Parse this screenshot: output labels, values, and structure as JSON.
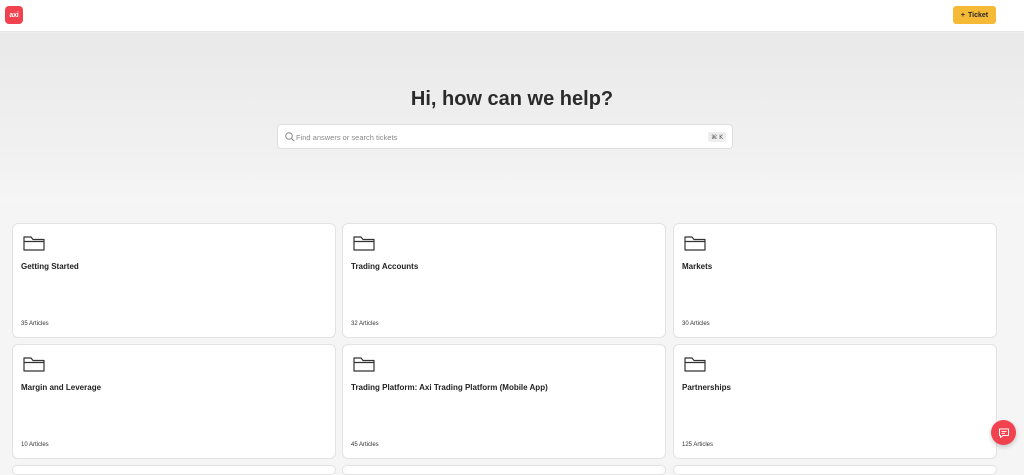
{
  "header": {
    "logo_text": "axi",
    "ticket_button_label": "Ticket",
    "ticket_button_icon": "plus-icon"
  },
  "hero": {
    "title": "Hi, how can we help?",
    "search": {
      "placeholder": "Find answers or search tickets",
      "value": "",
      "shortcut": "⌘ K"
    }
  },
  "categories": [
    {
      "title": "Getting Started",
      "count": "35 Articles",
      "icon": "folder-icon"
    },
    {
      "title": "Trading Accounts",
      "count": "32 Articles",
      "icon": "folder-icon"
    },
    {
      "title": "Markets",
      "count": "30 Articles",
      "icon": "folder-icon"
    },
    {
      "title": "Margin and Leverage",
      "count": "10 Articles",
      "icon": "folder-icon"
    },
    {
      "title": "Trading Platform: Axi Trading Platform (Mobile App)",
      "count": "45 Articles",
      "icon": "folder-icon"
    },
    {
      "title": "Partnerships",
      "count": "125 Articles",
      "icon": "folder-icon"
    }
  ],
  "chat_widget": {
    "icon": "chat-icon"
  },
  "colors": {
    "brand_red": "#f0434f",
    "ticket_yellow": "#f5b935",
    "page_background": "#f5f5f5"
  }
}
